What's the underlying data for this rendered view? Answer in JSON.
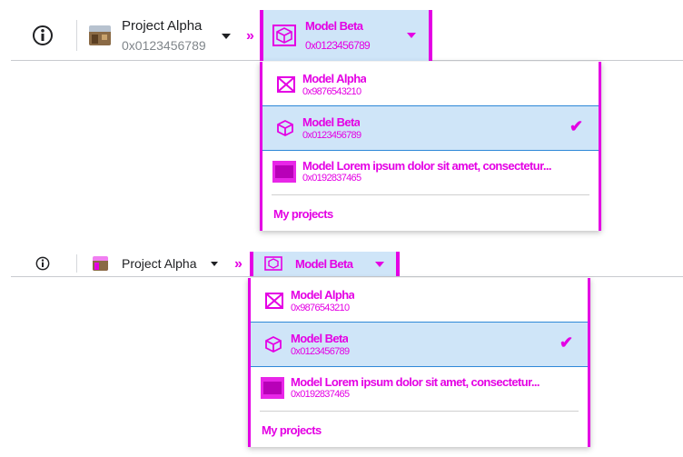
{
  "colors": {
    "accent": "#e400e4",
    "selected_bg": "#cfe5f8",
    "selected_border": "#2e88d8"
  },
  "toolbar": {
    "info_icon": "info-icon",
    "project": {
      "name": "Project Alpha",
      "address": "0x0123456789"
    },
    "model": {
      "name": "Model Beta",
      "address": "0x0123456789"
    }
  },
  "model_menu": {
    "items": [
      {
        "name": "Model Alpha",
        "address": "0x9876543210",
        "icon": "cube-crossed-icon",
        "selected": false
      },
      {
        "name": "Model Beta",
        "address": "0x0123456789",
        "icon": "cube-icon",
        "selected": true
      },
      {
        "name": "Model Lorem ipsum dolor sit amet, consectetur...",
        "address": "0x0192837465",
        "icon": "image-icon",
        "selected": false
      }
    ],
    "footer_link": "My projects"
  }
}
